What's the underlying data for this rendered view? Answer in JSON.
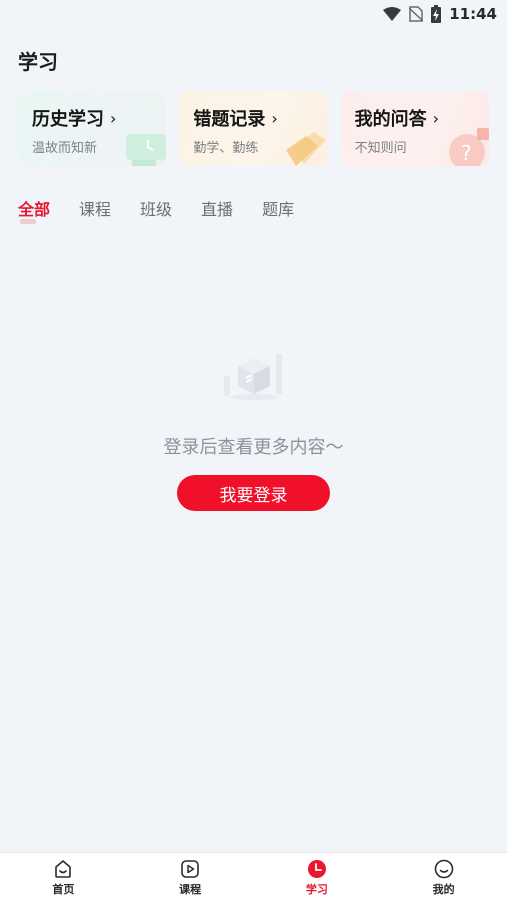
{
  "status_bar": {
    "time": "11:44",
    "icons": [
      "wifi-icon",
      "no-sim-icon",
      "battery-charging-icon"
    ]
  },
  "page": {
    "title": "学习"
  },
  "cards": [
    {
      "title": "历史学习",
      "subtitle": "温故而知新",
      "icon": "monitor-clock-icon"
    },
    {
      "title": "错题记录",
      "subtitle": "勤学、勤练",
      "icon": "paper-note-icon"
    },
    {
      "title": "我的问答",
      "subtitle": "不知则问",
      "icon": "question-bubble-icon"
    }
  ],
  "tabs": [
    "全部",
    "课程",
    "班级",
    "直播",
    "题库"
  ],
  "active_tab": "全部",
  "empty_state": {
    "icon": "empty-box-icon",
    "message": "登录后查看更多内容～",
    "button_label": "我要登录"
  },
  "bottom_nav": [
    {
      "label": "首页",
      "icon": "home-icon"
    },
    {
      "label": "课程",
      "icon": "play-icon"
    },
    {
      "label": "学习",
      "icon": "clock-icon",
      "active": true
    },
    {
      "label": "我的",
      "icon": "smile-icon"
    }
  ],
  "colors": {
    "accent": "#e8162f",
    "background": "#f1f4f8"
  }
}
